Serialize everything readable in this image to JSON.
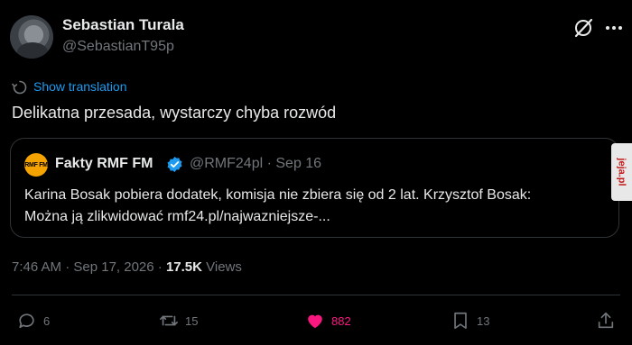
{
  "author": {
    "name": "Sebastian Turala",
    "handle": "@SebastianT95p"
  },
  "translate_label": "Show translation",
  "tweet_text": "Delikatna przesada, wystarczy chyba rozwód",
  "quoted": {
    "logo_text": "RMF FM",
    "name": "Fakty RMF FM",
    "handle_date": "@RMF24pl · Sep 16",
    "line1": "Karina Bosak pobiera dodatek, komisja nie zbiera się od 2 lat. Krzysztof Bosak:",
    "line2": "Można ją zlikwidować rmf24.pl/najwazniejsze-..."
  },
  "watermark": "jeja.pl",
  "meta": {
    "time_date": "7:46 AM · Sep 17, 2026 · ",
    "views_count": "17.5K",
    "views_label": " Views"
  },
  "actions": {
    "replies": "6",
    "reposts": "15",
    "likes": "882",
    "bookmarks": "13"
  },
  "colors": {
    "accent": "#1d9bf0",
    "like": "#f91880",
    "muted": "#71767b",
    "text": "#e7e9ea",
    "background": "#000000"
  },
  "icons": [
    "grok-icon",
    "more-icon",
    "translate-icon",
    "verified-icon",
    "reply-icon",
    "repost-icon",
    "like-icon",
    "bookmark-icon",
    "share-icon"
  ]
}
